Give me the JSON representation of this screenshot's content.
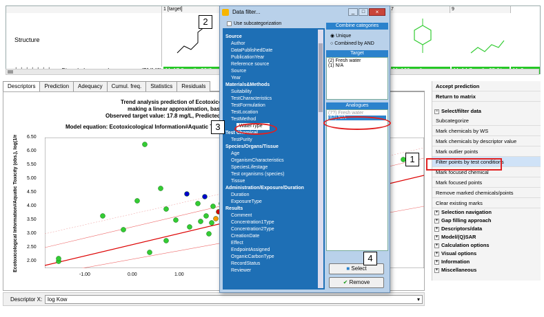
{
  "matrix": {
    "col1_header": "1 [target]",
    "col7_header": "7",
    "col9_header": "9",
    "row_label": "Structure",
    "species": "Pimephales promelas",
    "count": "(71/148)",
    "cell_target": "M: 17.8 mg/L, 22(2...",
    "cell_mid": "M: 160 mg/L",
    "cell_right": "M: 14.7 mg/L, 25.8(...",
    "cell_last": "M: 9"
  },
  "tabs": [
    "Descriptors",
    "Prediction",
    "Adequacy",
    "Cumul. freq.",
    "Statistics",
    "Residuals"
  ],
  "plot": {
    "title1": "Trend analysis prediction of Ecotoxicolo",
    "title2": "making a linear approximation, base",
    "title3": "Observed target value: 17.8 mg/L, Predicted ta",
    "model": "Model equation:  Ecotoxicological Information#Aquatic To",
    "ylabel": "Ecotoxicological Information#Aquatic Toxicity (obs.), log(1/mol/L)",
    "yticks": [
      "6.50",
      "6.00",
      "5.50",
      "5.00",
      "4.50",
      "4.00",
      "3.50",
      "3.00",
      "2.50",
      "2.00"
    ],
    "xticks": [
      "-1.00",
      "0.00",
      "1.00"
    ],
    "descriptor_label": "Descriptor X:",
    "descriptor_value": "log Kow"
  },
  "right_panel": {
    "accept": "Accept prediction",
    "return": "Return to matrix",
    "select_group": "Select/filter data",
    "items": [
      "Subcategorize",
      "Mark chemicals by WS",
      "Mark chemicals by descriptor value",
      "Mark outlier points",
      "Filter points by test conditions",
      "Mark focused chemical",
      "Mark focused points",
      "Remove marked chemicals/points",
      "Clear existing marks"
    ],
    "groups": [
      "Selection navigation",
      "Gap filling approach",
      "Descriptors/data",
      "Model/(Q)SAR",
      "Calculation options",
      "Visual options",
      "Information",
      "Miscellaneous"
    ]
  },
  "dialog": {
    "title": "Data filter...",
    "use_subcat": "Use subcategorization",
    "combine": "Combine categories",
    "opt_unique": "Unique",
    "opt_and": "Combined by AND",
    "target_hdr": "Target",
    "target_items": [
      "(2) Fresh water",
      "(1) N/A"
    ],
    "analogues_hdr": "Analogues",
    "analogue_items": [
      "(7?) Fresh water",
      "(67) N/A"
    ],
    "select_btn": "Select",
    "remove_btn": "Remove",
    "tree": [
      {
        "g": "Source",
        "c": [
          "Author",
          "DataPublishedDate",
          "PublicationYear",
          "Reference source",
          "Source",
          "Year"
        ]
      },
      {
        "g": "Materials&Methods",
        "c": [
          "Suitability",
          "TestCharacteristics",
          "TestFormulation",
          "TestLocation",
          "TestMethod",
          "WaterType"
        ]
      },
      {
        "g": "Test Chemical",
        "c": [
          "TestPurity"
        ]
      },
      {
        "g": "Species/Organs/Tissue",
        "c": [
          "Age",
          "OrganismCharacteristics",
          "SpeciesLifestage",
          "Test organisms (species)",
          "Tissue"
        ]
      },
      {
        "g": "Administration/Exposure/Duration",
        "c": [
          "Duration",
          "ExposureType"
        ]
      },
      {
        "g": "Results",
        "c": [
          "Comment",
          "Concentration1Type",
          "Concentration2Type",
          "CreationDate",
          "Effect",
          "EndpointAssigned",
          "OrganicCarbonType",
          "RecordStatus",
          "Reviewer"
        ]
      }
    ]
  },
  "callouts": [
    "1",
    "2",
    "3",
    "4"
  ],
  "colors": {
    "green": "#25c825",
    "tree_blue": "#1e6fb5",
    "highlight": "#e02020"
  }
}
